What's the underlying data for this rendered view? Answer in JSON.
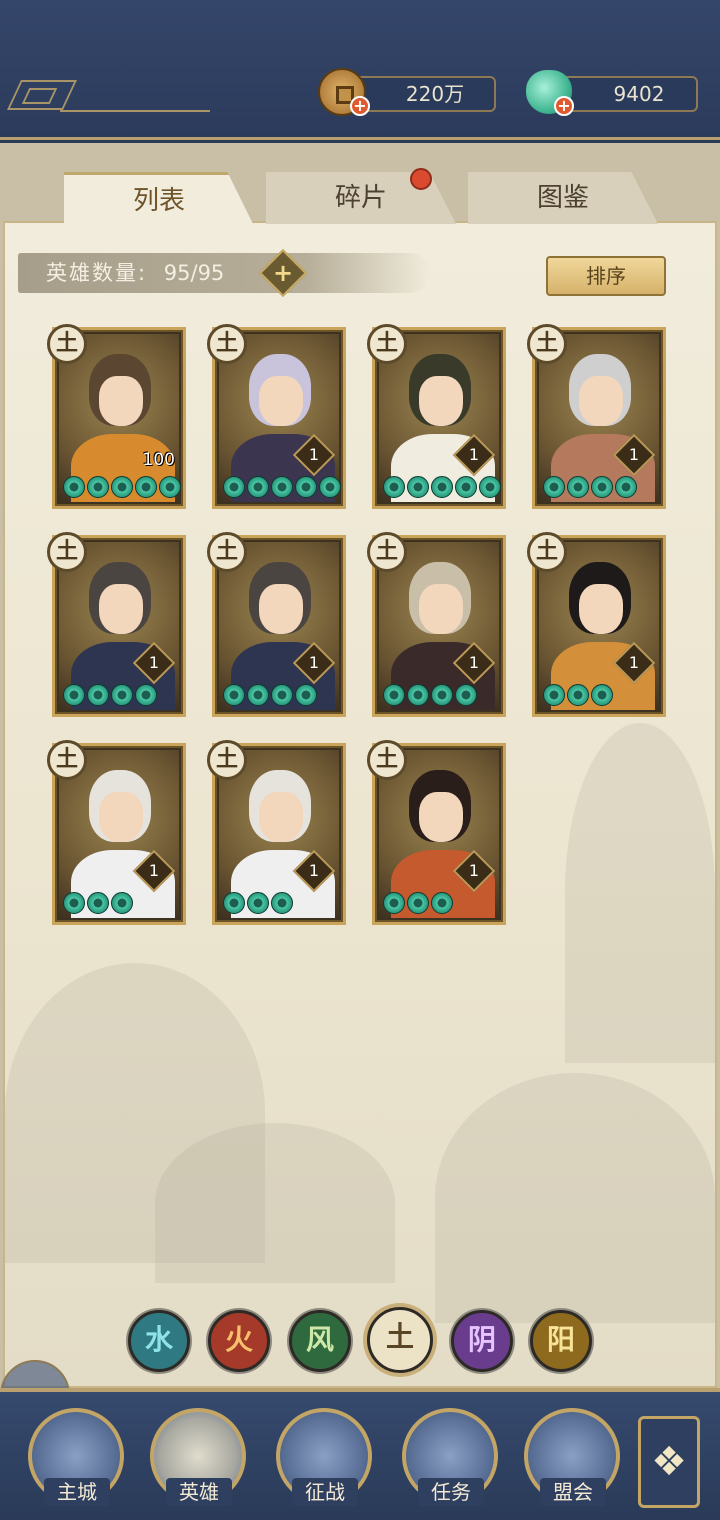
{
  "currency": {
    "coins": "220万",
    "jade": "9402",
    "plus": "+"
  },
  "tabs": [
    {
      "label": "列表",
      "active": true
    },
    {
      "label": "碎片",
      "active": false,
      "has_notification": true
    },
    {
      "label": "图鉴",
      "active": false
    }
  ],
  "hero_count": {
    "label": "英雄数量:",
    "value": "95/95",
    "add": "+"
  },
  "sort_button": "排序",
  "element_symbol": "土",
  "heroes": [
    {
      "level": "100",
      "stars": 5,
      "hair": "#5b4632",
      "outfit": "#d78a2e"
    },
    {
      "level": "1",
      "stars": 5,
      "hair": "#c9c3dc",
      "outfit": "#3b3550"
    },
    {
      "level": "1",
      "stars": 5,
      "hair": "#3a3a2a",
      "outfit": "#f0ece0"
    },
    {
      "level": "1",
      "stars": 4,
      "hair": "#cfcfcf",
      "outfit": "#b57a5e"
    },
    {
      "level": "1",
      "stars": 4,
      "hair": "#4a4540",
      "outfit": "#2e3550"
    },
    {
      "level": "1",
      "stars": 4,
      "hair": "#4a4540",
      "outfit": "#2e3550"
    },
    {
      "level": "1",
      "stars": 4,
      "hair": "#c9bfa8",
      "outfit": "#3a2a2a"
    },
    {
      "level": "1",
      "stars": 3,
      "hair": "#1e1a1a",
      "outfit": "#d48f3a"
    },
    {
      "level": "1",
      "stars": 3,
      "hair": "#e6e2dc",
      "outfit": "#efefef"
    },
    {
      "level": "1",
      "stars": 3,
      "hair": "#e6e2dc",
      "outfit": "#efefef"
    },
    {
      "level": "1",
      "stars": 3,
      "hair": "#2a1e1a",
      "outfit": "#c45a2e"
    }
  ],
  "element_filters": [
    {
      "symbol": "水",
      "color": "#2f7a82",
      "text": "#8fe3e8"
    },
    {
      "symbol": "火",
      "color": "#a53a2a",
      "text": "#f7c06a"
    },
    {
      "symbol": "风",
      "color": "#2f6a3e",
      "text": "#cfe8a8"
    },
    {
      "symbol": "土",
      "color": "#ece2c6",
      "text": "#5a4524",
      "active": true
    },
    {
      "symbol": "阴",
      "color": "#6a3c8e",
      "text": "#e5c4ff"
    },
    {
      "symbol": "阳",
      "color": "#8e6a1e",
      "text": "#f7e39a"
    }
  ],
  "bottom_nav": [
    {
      "label": "主城"
    },
    {
      "label": "英雄",
      "active": true
    },
    {
      "label": "征战"
    },
    {
      "label": "任务"
    },
    {
      "label": "盟会"
    }
  ],
  "menu_icon": "❖"
}
